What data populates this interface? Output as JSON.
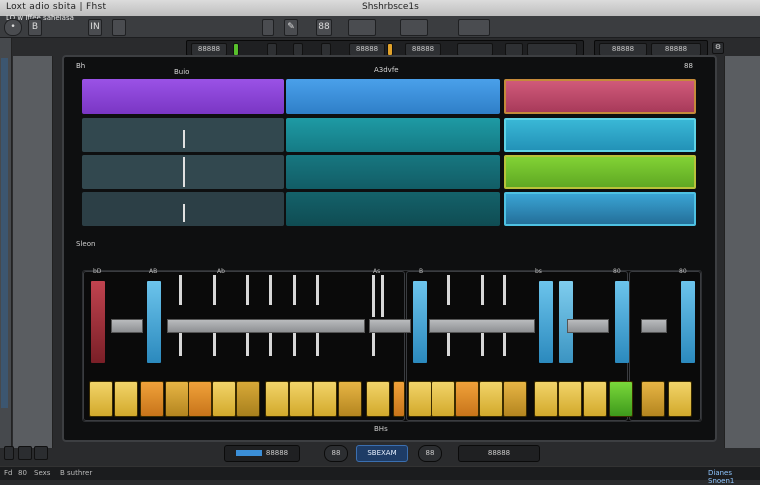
{
  "window": {
    "title_left": "Loxt adio sbita | Fhst",
    "title_center": "Shshrbsce1s",
    "subtitle": "LO w Iffee saheiasa"
  },
  "toolbar": {
    "buttons": [
      "B",
      "•",
      "IN",
      "✎",
      "88"
    ],
    "transport": {
      "field_a": "88888",
      "field_b": "88888",
      "field_c": "88888",
      "right_a": "88888",
      "right_b": "88888"
    }
  },
  "arrange": {
    "header_left": "Bh",
    "header_mid": "Buio",
    "header_center": "A3dvfe",
    "header_right": "88",
    "section_label": "Sleon",
    "tracks": [
      {
        "clips": [
          {
            "color": "#8b3fd6"
          },
          {
            "color": "#3b8fd8"
          },
          {
            "color": "#c2486a"
          }
        ]
      },
      {
        "clips": [
          {
            "color": "#2f4752"
          },
          {
            "color": "#1a8a94"
          },
          {
            "color": "#2aa5c9"
          }
        ]
      },
      {
        "clips": [
          {
            "color": "#2f4752"
          },
          {
            "color": "#176d74"
          },
          {
            "color": "#6fbb2c"
          }
        ]
      },
      {
        "clips": [
          {
            "color": "#2b3e45"
          },
          {
            "color": "#135a60"
          },
          {
            "color": "#2c8dc2"
          }
        ]
      }
    ]
  },
  "mixer": {
    "labels": [
      "bD",
      "AB",
      "Ab",
      "As",
      "B",
      "bs",
      "80",
      "80"
    ],
    "bottom_label": "BHs"
  },
  "bottom": {
    "field_left": "88888",
    "round_a": "88",
    "button_mid": "SBEXAM",
    "round_b": "88",
    "field_right": "88888"
  },
  "status": {
    "left": "Fd",
    "mid1": "80",
    "mid2": "Sexs",
    "mid3": "B suthrer",
    "right": "Dianes Snoen1"
  }
}
